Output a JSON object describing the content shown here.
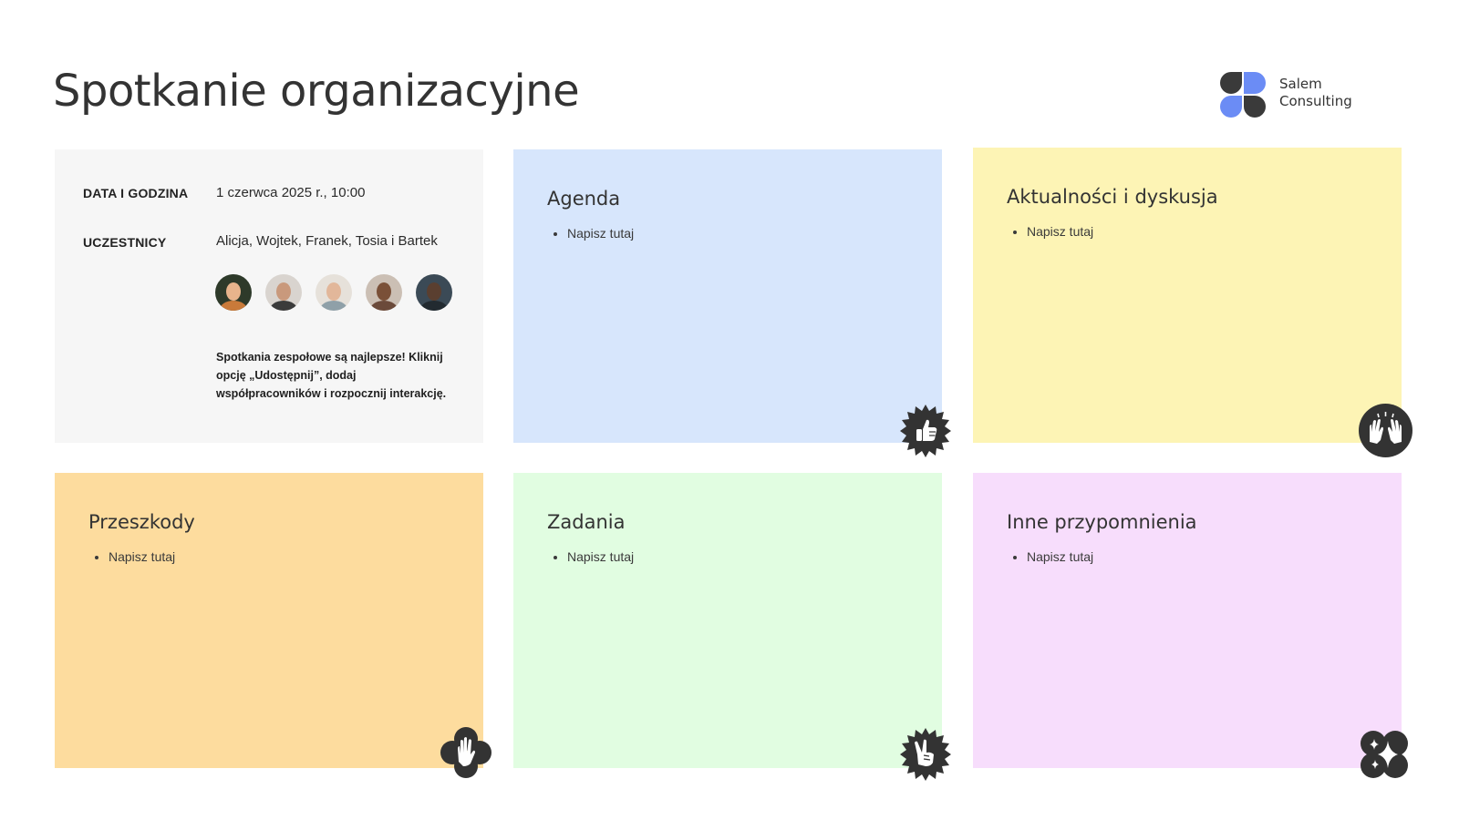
{
  "page": {
    "title": "Spotkanie organizacyjne"
  },
  "logo": {
    "line1": "Salem",
    "line2": "Consulting",
    "colors": {
      "dark": "#3a3a3a",
      "blue": "#6b8cf5"
    }
  },
  "info_card": {
    "date_label": "DATA I GODZINA",
    "date_value": "1 czerwca 2025 r., 10:00",
    "participants_label": "UCZESTNICY",
    "participants_value": "Alicja, Wojtek, Franek, Tosia i Bartek",
    "avatars": [
      "avatar-1",
      "avatar-2",
      "avatar-3",
      "avatar-4",
      "avatar-5"
    ],
    "note": "Spotkania zespołowe są najlepsze! Kliknij opcję „Udostępnij”, dodaj współpracowników i rozpocznij interakcję."
  },
  "cards": {
    "agenda": {
      "heading": "Agenda",
      "item": "Napisz tutaj",
      "color": "#d7e6fc",
      "icon": "thumbs-up-icon"
    },
    "news": {
      "heading": "Aktualności i dyskusja",
      "item": "Napisz tutaj",
      "color": "#fdf4b5",
      "icon": "raised-hands-icon"
    },
    "obstacles": {
      "heading": "Przeszkody",
      "item": "Napisz tutaj",
      "color": "#fddc9e",
      "icon": "stop-hand-icon"
    },
    "tasks": {
      "heading": "Zadania",
      "item": "Napisz tutaj",
      "color": "#e1fde1",
      "icon": "peace-hand-icon"
    },
    "reminders": {
      "heading": "Inne przypomnienia",
      "item": "Napisz tutaj",
      "color": "#f7ddfc",
      "icon": "sparkles-icon"
    }
  }
}
